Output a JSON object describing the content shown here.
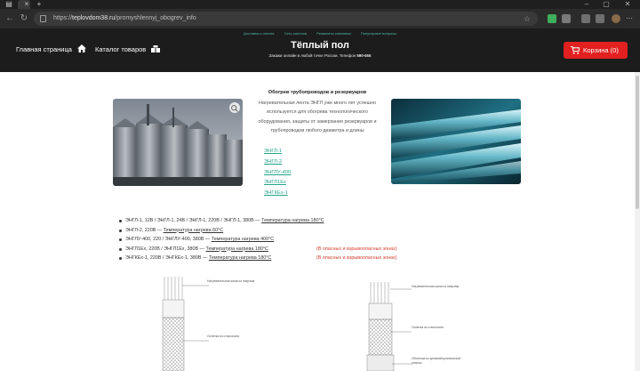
{
  "browser": {
    "url_prefix": "https://",
    "url_host": "teplovdom38.ru",
    "url_path": "/promyshlennyj_obogrev_info"
  },
  "header": {
    "top_links": [
      "Доставка и оплата",
      "Сеть салонов",
      "Реквизиты компании",
      "Популярные вопросы"
    ],
    "home_label": "Главная страница",
    "catalog_label": "Каталог товаров",
    "title": "Тёплый пол",
    "subtitle": "Закажи онлайн в любой точке России. Телефон",
    "phone": "590-555",
    "cart_label": "Корзина (0)"
  },
  "section": {
    "title": "Обогрев трубопроводов и резервуаров",
    "description": "Нагревательная лента ЭНГЛ уже много лет успешно используется для обогрева технологического оборудования, защиты от замерзания резервуаров и трубопроводов любого диаметра и длины",
    "links": [
      "ЭНГЛ-1",
      "ЭНГЛ-2",
      "ЭНГЛУ-400",
      "ЭНГЛ1Ех",
      "ЭНГКЕх-1"
    ]
  },
  "specs": [
    {
      "models": "ЭНГЛ-1, 12В / ЭНГЛ-1, 24В / ЭНГЛ-1, 220В / ЭНГЛ-1, 380В — ",
      "temp": "Температура нагрева 180°С",
      "note": ""
    },
    {
      "models": "ЭНГЛ-2, 220В — ",
      "temp": "Температура нагрева 60°С",
      "note": ""
    },
    {
      "models": "ЭНГЛУ-400, 220 / ЭНГЛУ-400, 380В — ",
      "temp": "Температура нагрева 400°С",
      "note": ""
    },
    {
      "models": "ЭНГЛ1Ех, 220В / ЭНГЛ1Ех, 380В — ",
      "temp": "Температура нагрева 180°С",
      "note": "(В опасных и взрывоопасных зонах)"
    },
    {
      "models": "ЭНГКЕх-1, 220В / ЭНГКЕх-1, 380В — ",
      "temp": "Температура нагрева 180°С",
      "note": "(В опасных и взрывоопасных зонах)"
    }
  ],
  "diagram_left": {
    "labels": [
      "Нагревательная жила из нихрома",
      "Оплетка из стеклонити"
    ]
  },
  "diagram_right": {
    "labels": [
      "Нагревательная жила из нихрома",
      "Оплетка из стеклонити",
      "Оболочка из кремнийорганической резины"
    ]
  },
  "colors": {
    "accent": "#21a58c",
    "cart": "#e22020",
    "warning": "#d23b2c"
  }
}
